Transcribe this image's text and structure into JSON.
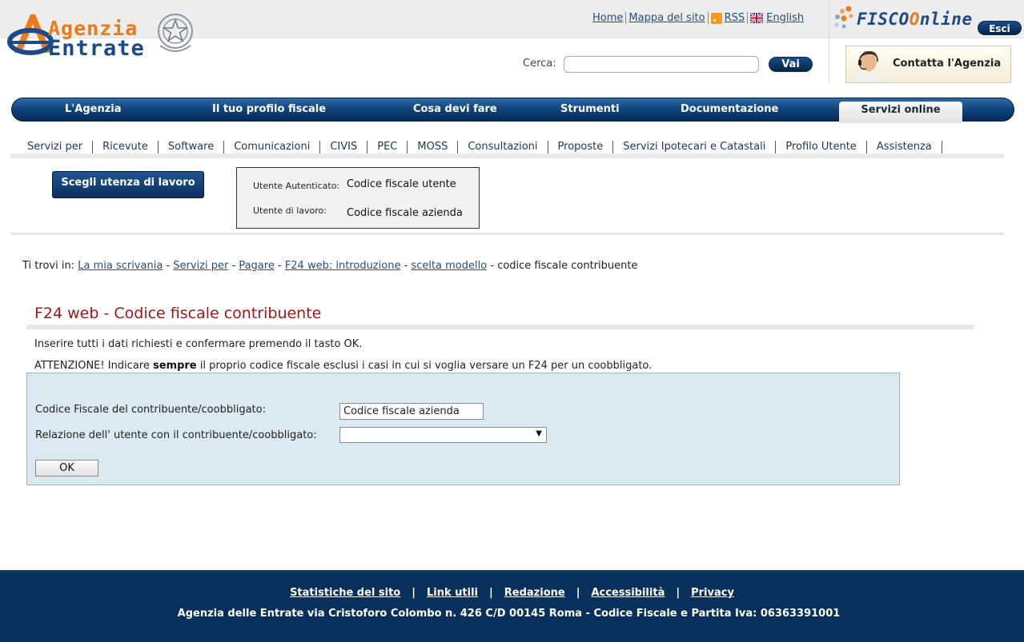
{
  "header": {
    "logo_line1": "Agenzia",
    "logo_line2": "Entrate",
    "top_links": {
      "home": "Home",
      "sitemap": "Mappa del sito",
      "rss": "RSS",
      "english": "English"
    },
    "fisco_brand": {
      "part1": "FISCO",
      "part2": "nline"
    },
    "logout_label": "Esci",
    "search": {
      "label": "Cerca:",
      "value": "",
      "button": "Vai"
    },
    "contact_label": "Contatta l'Agenzia"
  },
  "main_nav": {
    "items": [
      "L'Agenzia",
      "Il tuo profilo fiscale",
      "Cosa devi fare",
      "Strumenti",
      "Documentazione"
    ],
    "active": "Servizi online"
  },
  "sub_nav": {
    "items": [
      "Servizi per",
      "Ricevute",
      "Software",
      "Comunicazioni",
      "CIVIS",
      "PEC",
      "MOSS",
      "Consultazioni",
      "Proposte",
      "Servizi Ipotecari e Catastali",
      "Profilo Utente",
      "Assistenza"
    ]
  },
  "user_panel": {
    "choose_button": "Scegli utenza di lavoro",
    "auth_label": "Utente Autenticato:",
    "auth_value": "Codice fiscale utente",
    "work_label": "Utente di lavoro:",
    "work_value": "Codice fiscale azienda"
  },
  "breadcrumb": {
    "prefix": "Ti trovi in:",
    "links": [
      "La mia scrivania",
      "Servizi per",
      "Pagare",
      "F24 web: introduzione",
      "scelta modello"
    ],
    "current": "codice fiscale contribuente",
    "separator": "-"
  },
  "content": {
    "title": "F24 web - Codice fiscale contribuente",
    "instruction": "Inserire tutti i dati richiesti e confermare premendo il tasto OK.",
    "warning_pre": "ATTENZIONE! Indicare",
    "warning_bold": "sempre",
    "warning_post": "il proprio codice fiscale esclusi i casi in cui si voglia versare un F24 per un coobbligato."
  },
  "form": {
    "cf_label": "Codice Fiscale del contribuente/coobbligato:",
    "cf_value": "Codice fiscale azienda",
    "relation_label": "Relazione dell' utente con il contribuente/coobbligato:",
    "relation_value": "",
    "ok_label": "OK"
  },
  "footer": {
    "links": [
      "Statistiche del sito",
      "Link utili",
      "Redazione",
      "Accessibilità",
      "Privacy"
    ],
    "separator": "|",
    "address": "Agenzia delle Entrate via Cristoforo Colombo n. 426 C/D 00145 Roma - Codice Fiscale e Partita Iva: 06363391001"
  },
  "colors": {
    "nav_blue": "#10457f",
    "title_red": "#a01818",
    "brand_orange": "#ec7a1c",
    "form_bg": "#dbeaf0",
    "footer_bg": "#08305c"
  },
  "icons": [
    "logo-a-icon",
    "emblem-icon",
    "rss-icon",
    "uk-flag-icon",
    "fisco-dots-icon",
    "contact-person-icon",
    "dropdown-arrow-icon"
  ]
}
